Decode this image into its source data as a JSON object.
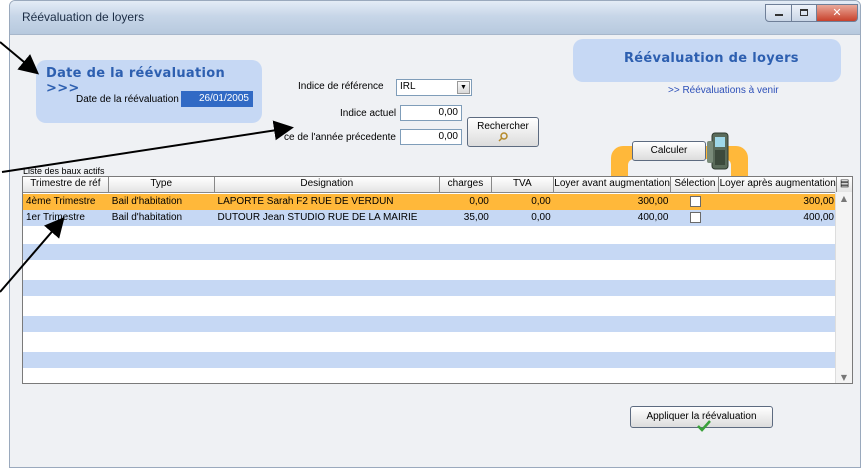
{
  "window": {
    "title": "Réévaluation de loyers"
  },
  "date_panel": {
    "heading": "Date de la réévaluation >>>",
    "field_label": "Date de la réévaluation",
    "field_value": "26/01/2005"
  },
  "title_panel": {
    "heading": "Réévaluation de loyers"
  },
  "upcoming_link": ">> Réévaluations à venir",
  "index": {
    "ref_label": "Indice de référence",
    "ref_value": "IRL",
    "current_label": "Indice actuel",
    "current_value": "0,00",
    "prev_label": "ce de l'année précedente",
    "prev_value": "0,00"
  },
  "buttons": {
    "search": "Rechercher",
    "calculate": "Calculer",
    "apply": "Appliquer la réévaluation"
  },
  "grid": {
    "label": "Liste des baux actifs",
    "columns": [
      "Trimestre de réf",
      "Type",
      "Designation",
      "charges",
      "TVA",
      "Loyer avant augmentation",
      "Sélection",
      "Loyer après augmentation"
    ],
    "rows": [
      {
        "trimestre": "4ème Trimestre",
        "type": "Bail d'habitation",
        "designation": "LAPORTE Sarah F2 RUE DE VERDUN",
        "charges": "0,00",
        "tva": "0,00",
        "loyer_avant": "300,00",
        "selection": false,
        "loyer_apres": "300,00"
      },
      {
        "trimestre": "1er Trimestre",
        "type": "Bail d'habitation",
        "designation": "DUTOUR Jean STUDIO RUE DE LA MAIRIE",
        "charges": "35,00",
        "tva": "0,00",
        "loyer_avant": "400,00",
        "selection": false,
        "loyer_apres": "400,00"
      }
    ]
  },
  "colors": {
    "panel": "#c6d8f4",
    "accent": "#2d5fb0",
    "selected_row": "#ffb83a",
    "stripe": "#c6d8f4"
  },
  "icons": [
    "search-magnifier-icon",
    "mobile-phone-icon",
    "checkmark-icon",
    "grid-options-icon"
  ]
}
